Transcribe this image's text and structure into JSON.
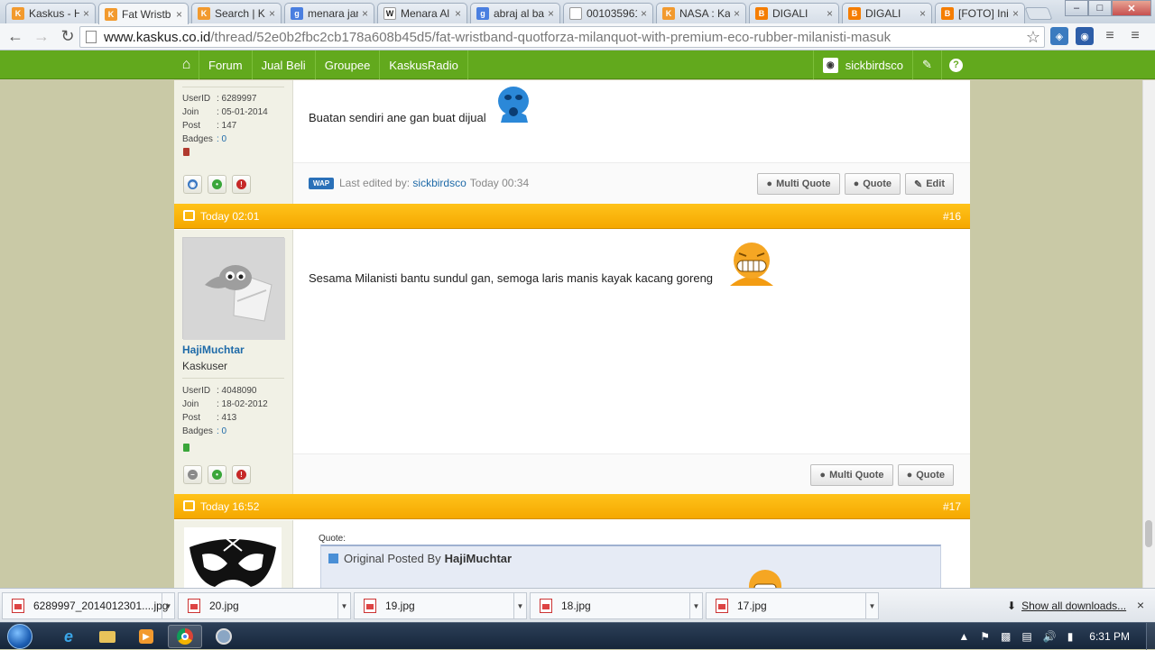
{
  "browser": {
    "tabs": [
      {
        "label": "Kaskus - H",
        "favicon_color": "#f29a2e",
        "favicon": "K"
      },
      {
        "label": "Fat Wristb",
        "favicon_color": "#f29a2e",
        "favicon": "K"
      },
      {
        "label": "Search | Ka",
        "favicon_color": "#f29a2e",
        "favicon": "K"
      },
      {
        "label": "menara jam",
        "favicon_color": "#4a7fe0",
        "favicon": "g"
      },
      {
        "label": "Menara Al",
        "favicon_color": "#ffffff",
        "favicon": "W"
      },
      {
        "label": "abraj al ba",
        "favicon_color": "#4a7fe0",
        "favicon": "g"
      },
      {
        "label": "001035961",
        "favicon_color": "#ffffff",
        "favicon": ""
      },
      {
        "label": "NASA : Ka",
        "favicon_color": "#f29a2e",
        "favicon": "K"
      },
      {
        "label": "DIGALI",
        "favicon_color": "#f57d00",
        "favicon": "B"
      },
      {
        "label": "DIGALI",
        "favicon_color": "#f57d00",
        "favicon": "B"
      },
      {
        "label": "[FOTO] Ini",
        "favicon_color": "#f57d00",
        "favicon": "B"
      }
    ],
    "close_glyph": "×",
    "window_buttons": [
      "–",
      "□",
      "✕"
    ],
    "url_host": "www.kaskus.co.id",
    "url_path": "/thread/52e0b2fbc2cb178a608b45d5/fat-wristband-quotforza-milanquot-with-premium-eco-rubber-milanisti-masuk"
  },
  "navbar": {
    "items": [
      "Forum",
      "Jual Beli",
      "Groupee",
      "KaskusRadio"
    ],
    "username": "sickbirdsco"
  },
  "posts": [
    {
      "user_info": [
        {
          "k": "UserID",
          "v": ": 6289997"
        },
        {
          "k": "Join",
          "v": ": 05-01-2014"
        },
        {
          "k": "Post",
          "v": ": 147"
        },
        {
          "k": "Badges",
          "v": ": 0"
        }
      ],
      "status_color": "#b03a2e",
      "text": "Buatan sendiri ane gan buat dijual",
      "edited_label": "Last edited by:",
      "edited_user": "sickbirdsco",
      "edited_time": "Today 00:34",
      "wap": "WAP",
      "buttons": [
        "Multi Quote",
        "Quote",
        "Edit"
      ]
    },
    {
      "time": "Today 02:01",
      "number": "#16",
      "username": "HajiMuchtar",
      "rank": "Kaskuser",
      "user_info": [
        {
          "k": "UserID",
          "v": ": 4048090"
        },
        {
          "k": "Join",
          "v": ": 18-02-2012"
        },
        {
          "k": "Post",
          "v": ": 413"
        },
        {
          "k": "Badges",
          "v": ": 0"
        }
      ],
      "status_color": "#3aa63a",
      "text": "Sesama Milanisti bantu sundul gan, semoga laris manis kayak kacang goreng",
      "buttons": [
        "Multi Quote",
        "Quote"
      ]
    },
    {
      "time": "Today 16:52",
      "number": "#17",
      "quote_label": "Quote:",
      "quote_prefix": "Original Posted By",
      "quote_user": "HajiMuchtar"
    }
  ],
  "downloads": {
    "items": [
      "6289997_2014012301....jpg",
      "20.jpg",
      "19.jpg",
      "18.jpg",
      "17.jpg"
    ],
    "show_all": "Show all downloads...",
    "close": "×"
  },
  "taskbar": {
    "time": "6:31 PM"
  }
}
